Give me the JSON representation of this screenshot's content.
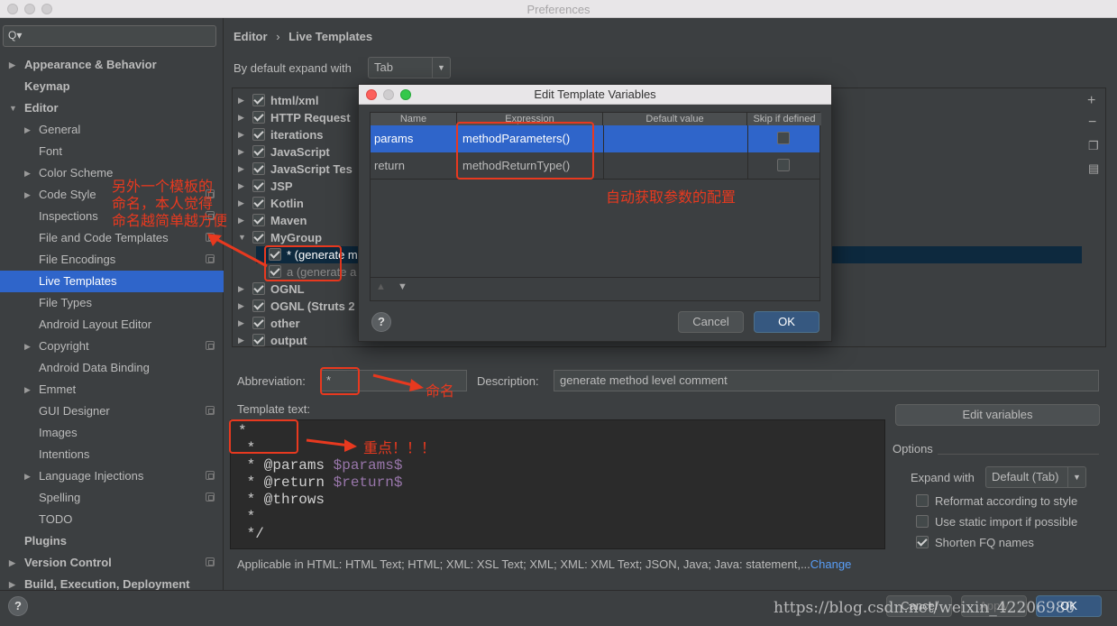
{
  "window": {
    "title": "Preferences"
  },
  "search": {
    "placeholder": "Q▾"
  },
  "sidebar": {
    "items": [
      {
        "label": "Appearance & Behavior"
      },
      {
        "label": "Keymap"
      },
      {
        "label": "Editor"
      },
      {
        "label": "General"
      },
      {
        "label": "Font"
      },
      {
        "label": "Color Scheme"
      },
      {
        "label": "Code Style"
      },
      {
        "label": "Inspections"
      },
      {
        "label": "File and Code Templates"
      },
      {
        "label": "File Encodings"
      },
      {
        "label": "Live Templates"
      },
      {
        "label": "File Types"
      },
      {
        "label": "Android Layout Editor"
      },
      {
        "label": "Copyright"
      },
      {
        "label": "Android Data Binding"
      },
      {
        "label": "Emmet"
      },
      {
        "label": "GUI Designer"
      },
      {
        "label": "Images"
      },
      {
        "label": "Intentions"
      },
      {
        "label": "Language Injections"
      },
      {
        "label": "Spelling"
      },
      {
        "label": "TODO"
      },
      {
        "label": "Plugins"
      },
      {
        "label": "Version Control"
      },
      {
        "label": "Build, Execution, Deployment"
      }
    ]
  },
  "breadcrumb": {
    "root": "Editor",
    "sep": "›",
    "page": "Live Templates"
  },
  "expand": {
    "label": "By default expand with",
    "value": "Tab"
  },
  "tree": {
    "groups": [
      "html/xml",
      "HTTP Request",
      "iterations",
      "JavaScript",
      "JavaScript Tes",
      "JSP",
      "Kotlin",
      "Maven",
      "MyGroup"
    ],
    "children": [
      "* (generate m",
      "a (generate a"
    ],
    "groups_after": [
      "OGNL",
      "OGNL (Struts 2",
      "other",
      "output"
    ]
  },
  "dialog": {
    "title": "Edit Template Variables",
    "columns": [
      "Name",
      "Expression",
      "Default value",
      "Skip if defined"
    ],
    "rows": [
      {
        "name": "params",
        "expression": "methodParameters()",
        "default": ""
      },
      {
        "name": "return",
        "expression": "methodReturnType()",
        "default": ""
      }
    ],
    "help": "?",
    "cancel": "Cancel",
    "ok": "OK"
  },
  "abbreviation": {
    "label": "Abbreviation:",
    "value": "*"
  },
  "description": {
    "label": "Description:",
    "value": "generate method level comment"
  },
  "template": {
    "label": "Template text:",
    "lines": [
      "*",
      " *",
      " * @params ",
      " * @return ",
      " * @throws",
      " *",
      " */"
    ],
    "vars": [
      "$params$",
      "$return$"
    ]
  },
  "edit_variables": "Edit variables",
  "options": {
    "title": "Options",
    "expand_label": "Expand with",
    "expand_value": "Default (Tab)",
    "checks": [
      {
        "label": "Reformat according to style",
        "checked": false
      },
      {
        "label": "Use static import if possible",
        "checked": false
      },
      {
        "label": "Shorten FQ names",
        "checked": true
      }
    ]
  },
  "applicable": {
    "text": "Applicable in HTML: HTML Text; HTML; XML: XSL Text; XML; XML: XML Text; JSON, Java; Java: statement,...",
    "change": "Change"
  },
  "bottom": {
    "help": "?",
    "cancel": "Cancel",
    "apply": "Apply",
    "ok": "OK"
  },
  "annotations": {
    "name_note": "另外一个模板的\n命名，本人觉得\n命名越简单越方便",
    "auto_note": "自动获取参数的配置",
    "naming": "命名",
    "key": "重点！！！"
  },
  "watermark": "https://blog.csdn.net/weixin_42206980",
  "colors": {
    "accent": "#2f65ca",
    "annotation": "#e8391f",
    "bg": "#3c3f41"
  }
}
